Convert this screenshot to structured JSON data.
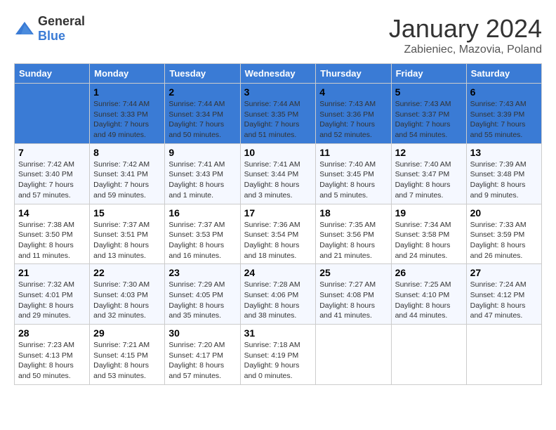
{
  "header": {
    "logo_general": "General",
    "logo_blue": "Blue",
    "title": "January 2024",
    "subtitle": "Zabieniec, Mazovia, Poland"
  },
  "days": [
    "Sunday",
    "Monday",
    "Tuesday",
    "Wednesday",
    "Thursday",
    "Friday",
    "Saturday"
  ],
  "weeks": [
    [
      {
        "date": "",
        "sunrise": "",
        "sunset": "",
        "daylight": ""
      },
      {
        "date": "1",
        "sunrise": "Sunrise: 7:44 AM",
        "sunset": "Sunset: 3:33 PM",
        "daylight": "Daylight: 7 hours and 49 minutes."
      },
      {
        "date": "2",
        "sunrise": "Sunrise: 7:44 AM",
        "sunset": "Sunset: 3:34 PM",
        "daylight": "Daylight: 7 hours and 50 minutes."
      },
      {
        "date": "3",
        "sunrise": "Sunrise: 7:44 AM",
        "sunset": "Sunset: 3:35 PM",
        "daylight": "Daylight: 7 hours and 51 minutes."
      },
      {
        "date": "4",
        "sunrise": "Sunrise: 7:43 AM",
        "sunset": "Sunset: 3:36 PM",
        "daylight": "Daylight: 7 hours and 52 minutes."
      },
      {
        "date": "5",
        "sunrise": "Sunrise: 7:43 AM",
        "sunset": "Sunset: 3:37 PM",
        "daylight": "Daylight: 7 hours and 54 minutes."
      },
      {
        "date": "6",
        "sunrise": "Sunrise: 7:43 AM",
        "sunset": "Sunset: 3:39 PM",
        "daylight": "Daylight: 7 hours and 55 minutes."
      }
    ],
    [
      {
        "date": "7",
        "sunrise": "Sunrise: 7:42 AM",
        "sunset": "Sunset: 3:40 PM",
        "daylight": "Daylight: 7 hours and 57 minutes."
      },
      {
        "date": "8",
        "sunrise": "Sunrise: 7:42 AM",
        "sunset": "Sunset: 3:41 PM",
        "daylight": "Daylight: 7 hours and 59 minutes."
      },
      {
        "date": "9",
        "sunrise": "Sunrise: 7:41 AM",
        "sunset": "Sunset: 3:43 PM",
        "daylight": "Daylight: 8 hours and 1 minute."
      },
      {
        "date": "10",
        "sunrise": "Sunrise: 7:41 AM",
        "sunset": "Sunset: 3:44 PM",
        "daylight": "Daylight: 8 hours and 3 minutes."
      },
      {
        "date": "11",
        "sunrise": "Sunrise: 7:40 AM",
        "sunset": "Sunset: 3:45 PM",
        "daylight": "Daylight: 8 hours and 5 minutes."
      },
      {
        "date": "12",
        "sunrise": "Sunrise: 7:40 AM",
        "sunset": "Sunset: 3:47 PM",
        "daylight": "Daylight: 8 hours and 7 minutes."
      },
      {
        "date": "13",
        "sunrise": "Sunrise: 7:39 AM",
        "sunset": "Sunset: 3:48 PM",
        "daylight": "Daylight: 8 hours and 9 minutes."
      }
    ],
    [
      {
        "date": "14",
        "sunrise": "Sunrise: 7:38 AM",
        "sunset": "Sunset: 3:50 PM",
        "daylight": "Daylight: 8 hours and 11 minutes."
      },
      {
        "date": "15",
        "sunrise": "Sunrise: 7:37 AM",
        "sunset": "Sunset: 3:51 PM",
        "daylight": "Daylight: 8 hours and 13 minutes."
      },
      {
        "date": "16",
        "sunrise": "Sunrise: 7:37 AM",
        "sunset": "Sunset: 3:53 PM",
        "daylight": "Daylight: 8 hours and 16 minutes."
      },
      {
        "date": "17",
        "sunrise": "Sunrise: 7:36 AM",
        "sunset": "Sunset: 3:54 PM",
        "daylight": "Daylight: 8 hours and 18 minutes."
      },
      {
        "date": "18",
        "sunrise": "Sunrise: 7:35 AM",
        "sunset": "Sunset: 3:56 PM",
        "daylight": "Daylight: 8 hours and 21 minutes."
      },
      {
        "date": "19",
        "sunrise": "Sunrise: 7:34 AM",
        "sunset": "Sunset: 3:58 PM",
        "daylight": "Daylight: 8 hours and 24 minutes."
      },
      {
        "date": "20",
        "sunrise": "Sunrise: 7:33 AM",
        "sunset": "Sunset: 3:59 PM",
        "daylight": "Daylight: 8 hours and 26 minutes."
      }
    ],
    [
      {
        "date": "21",
        "sunrise": "Sunrise: 7:32 AM",
        "sunset": "Sunset: 4:01 PM",
        "daylight": "Daylight: 8 hours and 29 minutes."
      },
      {
        "date": "22",
        "sunrise": "Sunrise: 7:30 AM",
        "sunset": "Sunset: 4:03 PM",
        "daylight": "Daylight: 8 hours and 32 minutes."
      },
      {
        "date": "23",
        "sunrise": "Sunrise: 7:29 AM",
        "sunset": "Sunset: 4:05 PM",
        "daylight": "Daylight: 8 hours and 35 minutes."
      },
      {
        "date": "24",
        "sunrise": "Sunrise: 7:28 AM",
        "sunset": "Sunset: 4:06 PM",
        "daylight": "Daylight: 8 hours and 38 minutes."
      },
      {
        "date": "25",
        "sunrise": "Sunrise: 7:27 AM",
        "sunset": "Sunset: 4:08 PM",
        "daylight": "Daylight: 8 hours and 41 minutes."
      },
      {
        "date": "26",
        "sunrise": "Sunrise: 7:25 AM",
        "sunset": "Sunset: 4:10 PM",
        "daylight": "Daylight: 8 hours and 44 minutes."
      },
      {
        "date": "27",
        "sunrise": "Sunrise: 7:24 AM",
        "sunset": "Sunset: 4:12 PM",
        "daylight": "Daylight: 8 hours and 47 minutes."
      }
    ],
    [
      {
        "date": "28",
        "sunrise": "Sunrise: 7:23 AM",
        "sunset": "Sunset: 4:13 PM",
        "daylight": "Daylight: 8 hours and 50 minutes."
      },
      {
        "date": "29",
        "sunrise": "Sunrise: 7:21 AM",
        "sunset": "Sunset: 4:15 PM",
        "daylight": "Daylight: 8 hours and 53 minutes."
      },
      {
        "date": "30",
        "sunrise": "Sunrise: 7:20 AM",
        "sunset": "Sunset: 4:17 PM",
        "daylight": "Daylight: 8 hours and 57 minutes."
      },
      {
        "date": "31",
        "sunrise": "Sunrise: 7:18 AM",
        "sunset": "Sunset: 4:19 PM",
        "daylight": "Daylight: 9 hours and 0 minutes."
      },
      {
        "date": "",
        "sunrise": "",
        "sunset": "",
        "daylight": ""
      },
      {
        "date": "",
        "sunrise": "",
        "sunset": "",
        "daylight": ""
      },
      {
        "date": "",
        "sunrise": "",
        "sunset": "",
        "daylight": ""
      }
    ]
  ]
}
